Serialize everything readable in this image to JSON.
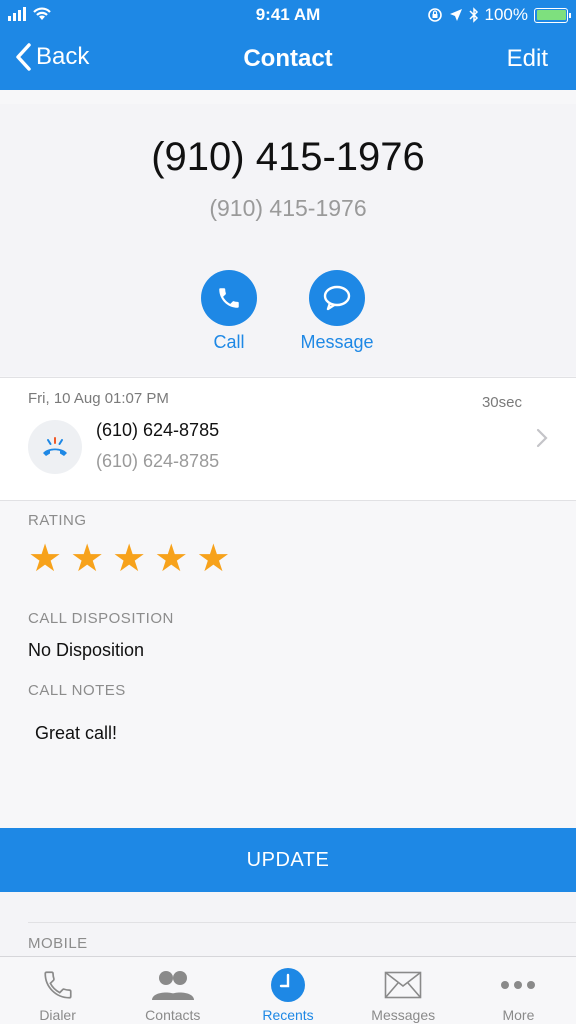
{
  "status_bar": {
    "time": "9:41 AM",
    "battery": "100%",
    "battery_level": 1.0
  },
  "nav": {
    "back_label": "Back",
    "title": "Contact",
    "edit_label": "Edit"
  },
  "contact": {
    "number_primary": "(910) 415-1976",
    "number_secondary": "(910) 415-1976"
  },
  "actions": {
    "call_label": "Call",
    "message_label": "Message"
  },
  "call_entry": {
    "date": "Fri, 10 Aug 01:07 PM",
    "duration": "30sec",
    "number_primary": "(610) 624-8785",
    "number_secondary": "(610) 624-8785",
    "icon": "phone-hangup-icon"
  },
  "rating": {
    "label": "RATING",
    "value": 5,
    "max": 5,
    "star": "★"
  },
  "disposition": {
    "label": "CALL DISPOSITION",
    "value": "No Disposition"
  },
  "notes": {
    "label": "CALL NOTES",
    "value": "Great call!"
  },
  "update_label": "UPDATE",
  "mobile_label": "MOBILE",
  "tabs": [
    {
      "label": "Dialer",
      "icon": "phone-icon",
      "active": false
    },
    {
      "label": "Contacts",
      "icon": "contacts-icon",
      "active": false
    },
    {
      "label": "Recents",
      "icon": "clock-icon",
      "active": true
    },
    {
      "label": "Messages",
      "icon": "envelope-icon",
      "active": false
    },
    {
      "label": "More",
      "icon": "more-icon",
      "active": false
    }
  ],
  "colors": {
    "accent": "#1e88e5",
    "star": "#f7a21b",
    "secondary_text": "#9a9a9a"
  }
}
